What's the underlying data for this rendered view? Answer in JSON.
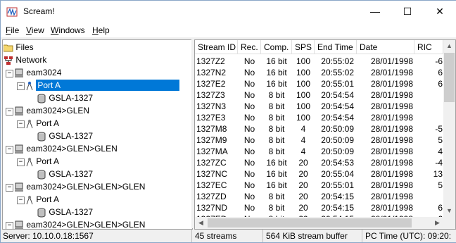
{
  "window": {
    "title": "Scream!",
    "minimize": "—",
    "maximize": "☐",
    "close": "✕"
  },
  "menu": [
    {
      "label_first": "F",
      "label_rest": "ile"
    },
    {
      "label_first": "V",
      "label_rest": "iew"
    },
    {
      "label_first": "W",
      "label_rest": "indows"
    },
    {
      "label_first": "H",
      "label_rest": "elp"
    }
  ],
  "tree": {
    "files": "Files",
    "network": "Network",
    "nodes": [
      {
        "server": "eam3024",
        "port": "Port A",
        "stream": "GSLA-1327",
        "selected": true
      },
      {
        "server": "eam3024>GLEN",
        "port": "Port A",
        "stream": "GSLA-1327"
      },
      {
        "server": "eam3024>GLEN>GLEN",
        "port": "Port A",
        "stream": "GSLA-1327"
      },
      {
        "server": "eam3024>GLEN>GLEN>GLEN",
        "port": "Port A",
        "stream": "GSLA-1327"
      },
      {
        "server": "eam3024>GLEN>GLEN>GLEN"
      }
    ]
  },
  "table": {
    "columns": [
      "Stream ID",
      "Rec.",
      "Comp.",
      "SPS",
      "End Time",
      "Date",
      "RIC"
    ],
    "rows": [
      [
        "1327Z2",
        "No",
        "16 bit",
        "100",
        "20:55:02",
        "28/01/1998",
        "-6"
      ],
      [
        "1327N2",
        "No",
        "16 bit",
        "100",
        "20:55:02",
        "28/01/1998",
        "6"
      ],
      [
        "1327E2",
        "No",
        "16 bit",
        "100",
        "20:55:01",
        "28/01/1998",
        "6"
      ],
      [
        "1327Z3",
        "No",
        "8 bit",
        "100",
        "20:54:54",
        "28/01/1998",
        ""
      ],
      [
        "1327N3",
        "No",
        "8 bit",
        "100",
        "20:54:54",
        "28/01/1998",
        ""
      ],
      [
        "1327E3",
        "No",
        "8 bit",
        "100",
        "20:54:54",
        "28/01/1998",
        ""
      ],
      [
        "1327M8",
        "No",
        "8 bit",
        "4",
        "20:50:09",
        "28/01/1998",
        "-5"
      ],
      [
        "1327M9",
        "No",
        "8 bit",
        "4",
        "20:50:09",
        "28/01/1998",
        "5"
      ],
      [
        "1327MA",
        "No",
        "8 bit",
        "4",
        "20:50:09",
        "28/01/1998",
        "4"
      ],
      [
        "1327ZC",
        "No",
        "16 bit",
        "20",
        "20:54:53",
        "28/01/1998",
        "-4"
      ],
      [
        "1327NC",
        "No",
        "16 bit",
        "20",
        "20:55:04",
        "28/01/1998",
        "13"
      ],
      [
        "1327EC",
        "No",
        "16 bit",
        "20",
        "20:55:01",
        "28/01/1998",
        "5"
      ],
      [
        "1327ZD",
        "No",
        "8 bit",
        "20",
        "20:54:15",
        "28/01/1998",
        ""
      ],
      [
        "1327ND",
        "No",
        "8 bit",
        "20",
        "20:54:15",
        "28/01/1998",
        "6"
      ],
      [
        "1327ED",
        "No",
        "8 bit",
        "20",
        "20:54:15",
        "28/01/1998",
        "6"
      ]
    ]
  },
  "status": {
    "server": "Server: 10.10.0.18:1567",
    "streams": "45 streams",
    "buffer": "564 KiB stream buffer",
    "pctime": "PC Time (UTC):  09:20:"
  },
  "colors": {
    "selection": "#0078d7",
    "folder": "#f5d76e"
  }
}
